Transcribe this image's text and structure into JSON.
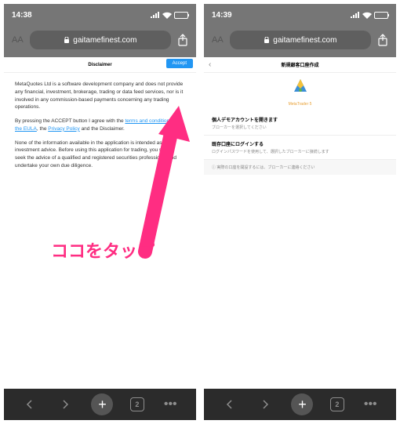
{
  "left": {
    "time": "14:38",
    "url": "gaitamefinest.com",
    "header": "Disclaimer",
    "accept": "Accept",
    "p1": "MetaQuotes Ltd is a software development company and does not provide any financial, investment, brokerage, trading or data feed services, nor is it involved in any commission-based payments concerning any trading operations.",
    "p2_pre": "By pressing the ACCEPT button I agree with the ",
    "p2_link1": "terms and conditions of the EULA",
    "p2_mid": ", the ",
    "p2_link2": "Privacy Policy",
    "p2_post": " and the Disclaimer.",
    "p3": "None of the information available in the application is intended as an investment advice. Before using this application for trading, you should seek the advice of a qualified and registered securities professional and undertake your own due diligence.",
    "tab_count": "2"
  },
  "right": {
    "time": "14:39",
    "url": "gaitamefinest.com",
    "header": "新規銀客口座作成",
    "brand": "MetaTrader 5",
    "item1_title": "個人デモアカウントを開きます",
    "item1_sub": "ブローカーを選択してください",
    "item2_title": "既存口座にログインする",
    "item2_sub": "ログインパスワードを使用して、選択したブローカーに接続します",
    "info": "実際の口座を開設するには、ブローカーに連絡ください",
    "tab_count": "2"
  },
  "callout": "ココをタップ"
}
